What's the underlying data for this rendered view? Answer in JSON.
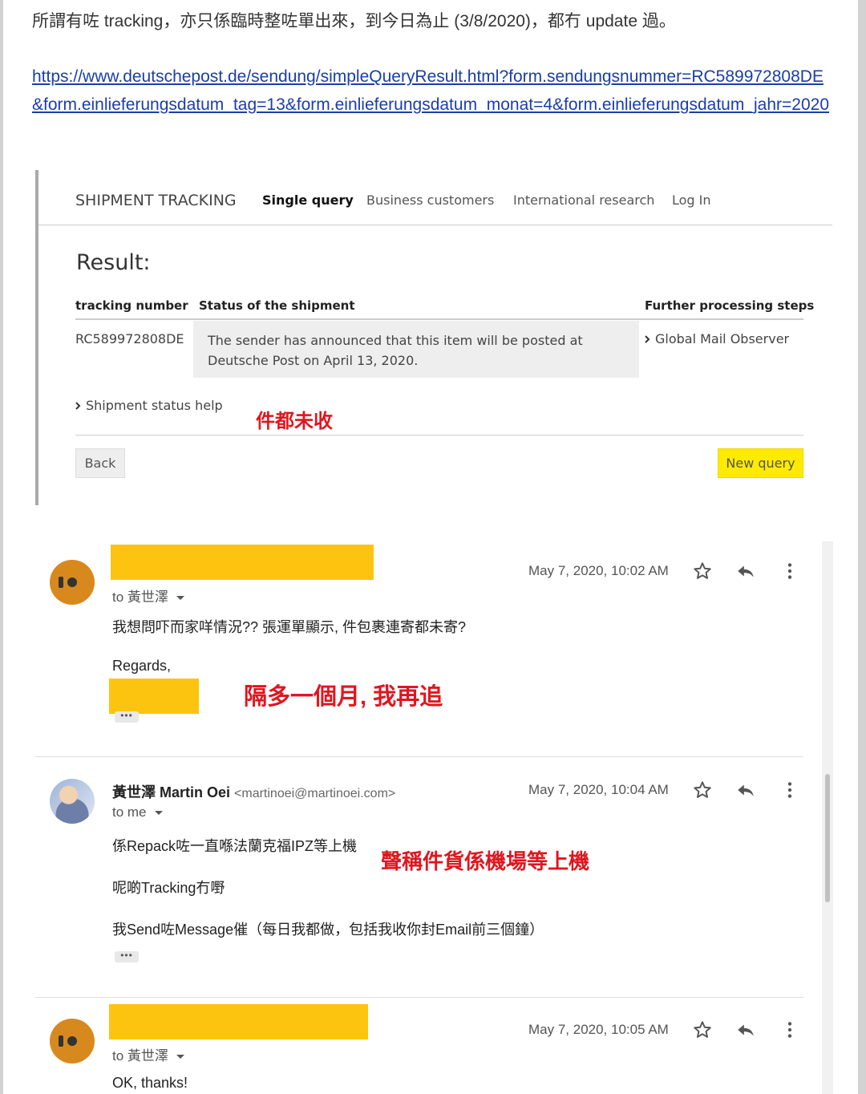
{
  "intro": {
    "text": "所謂有咗 tracking，亦只係臨時整咗單出來，到今日為止 (3/8/2020)，都冇 update 過。",
    "link": "https://www.deutschepost.de/sendung/simpleQueryResult.html?form.sendungsnummer=RC589972808DE&form.einlieferungsdatum_tag=13&form.einlieferungsdatum_monat=4&form.einlieferungsdatum_jahr=2020"
  },
  "tracking": {
    "brand": "SHIPMENT TRACKING",
    "nav": [
      "Single query",
      "Business customers",
      "International research",
      "Log In"
    ],
    "result_title": "Result:",
    "headers": {
      "number": "tracking number",
      "status": "Status of the shipment",
      "further": "Further processing steps"
    },
    "row": {
      "number": "RC589972808DE",
      "status": "The sender has announced that this item will be posted at Deutsche Post on April 13, 2020.",
      "further": "Global Mail Observer"
    },
    "help": "Shipment status help",
    "back": "Back",
    "new_query": "New query",
    "annotation": "件都未收"
  },
  "emails": [
    {
      "date": "May 7, 2020, 10:02 AM",
      "to": "to 黃世澤",
      "lines": [
        "我想問吓而家咩情況?? 張運單顯示, 件包裹連寄都未寄?",
        "Regards,"
      ],
      "annotation": "隔多一個月, 我再追"
    },
    {
      "sender_name": "黃世澤 Martin Oei",
      "sender_email": "<martinoei@martinoei.com>",
      "date": "May 7, 2020, 10:04 AM",
      "to": "to me",
      "lines": [
        "係Repack咗一直喺法蘭克福IPZ等上機",
        "呢啲Tracking冇嘢",
        "我Send咗Message催（每日我都做，包括我收你封Email前三個鐘）"
      ],
      "annotation": "聲稱件貨係機場等上機"
    },
    {
      "date": "May 7, 2020, 10:05 AM",
      "to": "to 黃世澤",
      "lines": [
        "OK, thanks!"
      ]
    }
  ],
  "colors": {
    "highlight_yellow": "#ffea00",
    "redaction": "#fdc40f",
    "annotation_red": "#e0161f",
    "avatar_orange": "#d8891e"
  }
}
